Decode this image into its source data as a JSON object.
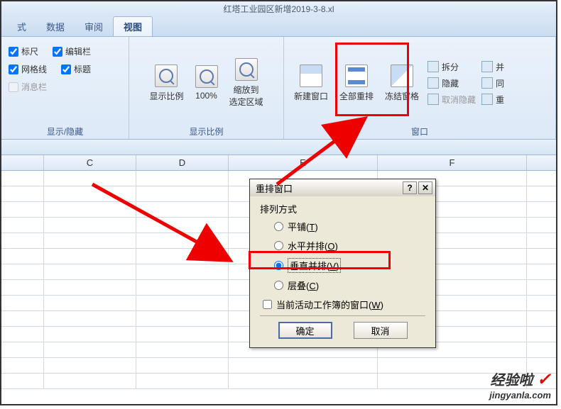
{
  "title": "红塔工业园区新增2019-3-8.xl",
  "tabs": [
    "式",
    "数据",
    "审阅",
    "视图"
  ],
  "active_tab_index": 3,
  "show_hide": {
    "ruler": {
      "label": "标尺",
      "checked": true
    },
    "formula_bar": {
      "label": "编辑栏",
      "checked": true
    },
    "gridlines": {
      "label": "网格线",
      "checked": true
    },
    "headings": {
      "label": "标题",
      "checked": true
    },
    "message_bar": {
      "label": "消息栏",
      "checked": false
    },
    "group_label": "显示/隐藏"
  },
  "zoom": {
    "zoom_label": "显示比例",
    "percent_label": "100%",
    "fit_label": "缩放到\n选定区域",
    "group_label": "显示比例"
  },
  "window": {
    "new_window": "新建窗口",
    "arrange_all": "全部重排",
    "freeze_panes": "冻结窗格",
    "split": "拆分",
    "hide": "隐藏",
    "unhide": "取消隐藏",
    "side_by1": "并",
    "side_by2": "同",
    "side_by3": "重",
    "group_label": "窗口"
  },
  "columns": [
    "",
    "C",
    "D",
    "E",
    "F"
  ],
  "dialog": {
    "title": "重排窗口",
    "help": "?",
    "close": "✕",
    "arrange_label": "排列方式",
    "tiled": "平铺",
    "tiled_key": "T",
    "horizontal": "水平并排",
    "horizontal_key": "O",
    "vertical": "垂直并排",
    "vertical_key": "V",
    "cascade": "层叠",
    "cascade_key": "C",
    "active_workbook": "当前活动工作簿的窗口",
    "active_workbook_key": "W",
    "selected": "vertical",
    "ok": "确定",
    "cancel": "取消"
  },
  "watermark": {
    "top": "经验啦",
    "bottom": "jingyanla.com"
  }
}
